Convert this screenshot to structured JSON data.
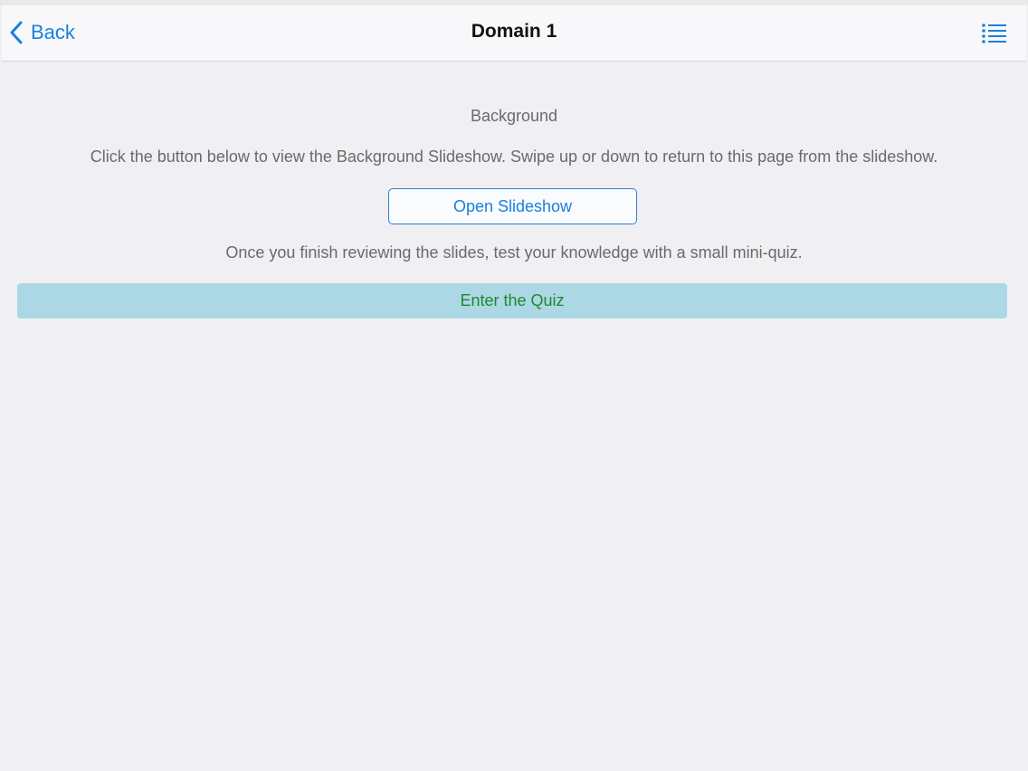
{
  "nav": {
    "back_label": "Back",
    "title": "Domain 1",
    "menu_icon": "list-menu-icon",
    "back_icon": "chevron-left-icon"
  },
  "content": {
    "section_title": "Background",
    "instructions": "Click the button below to view the Background Slideshow. Swipe up or down to return to this page from the slideshow.",
    "open_slideshow_label": "Open Slideshow",
    "quiz_note": "Once you finish reviewing the slides, test your knowledge with a small mini-quiz.",
    "enter_quiz_label": "Enter the Quiz"
  },
  "colors": {
    "accent": "#1a7fe0",
    "quiz_button_bg": "#acd8e6",
    "quiz_button_text": "#1c8a2c",
    "background": "#f0f0f2"
  }
}
